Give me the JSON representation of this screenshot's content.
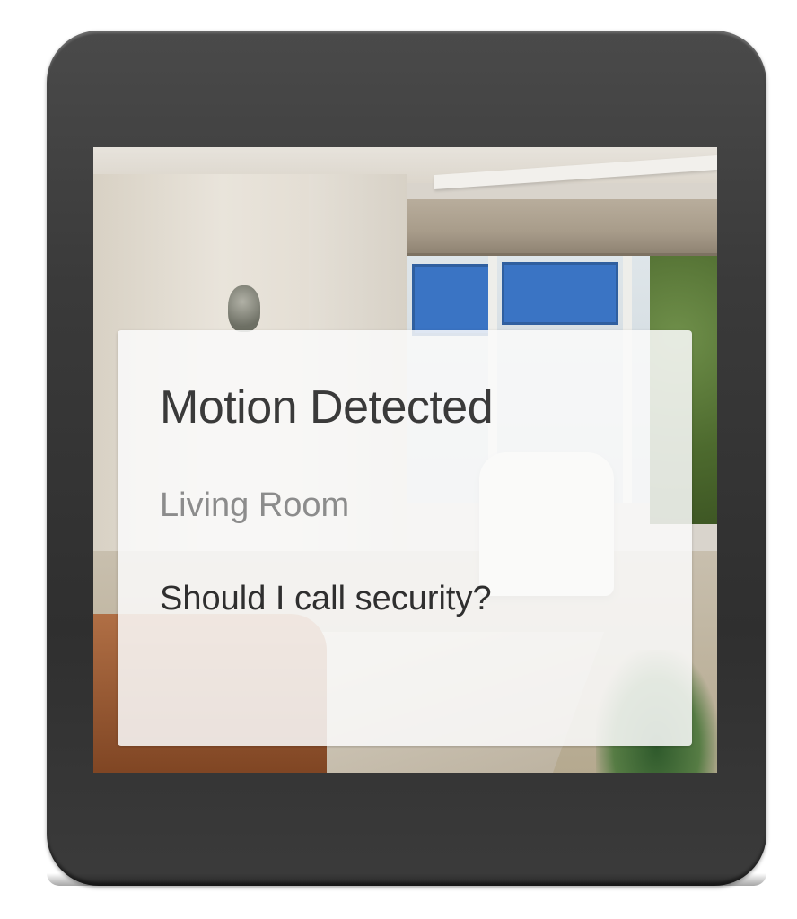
{
  "notification": {
    "title": "Motion Detected",
    "subtitle": "Living Room",
    "message": "Should I call security?"
  },
  "colors": {
    "watch_body": "#333333",
    "card_background": "#fafafa",
    "title_text": "#3a3a3a",
    "subtitle_text": "#8c8c8c",
    "message_text": "#2f2f2f"
  }
}
